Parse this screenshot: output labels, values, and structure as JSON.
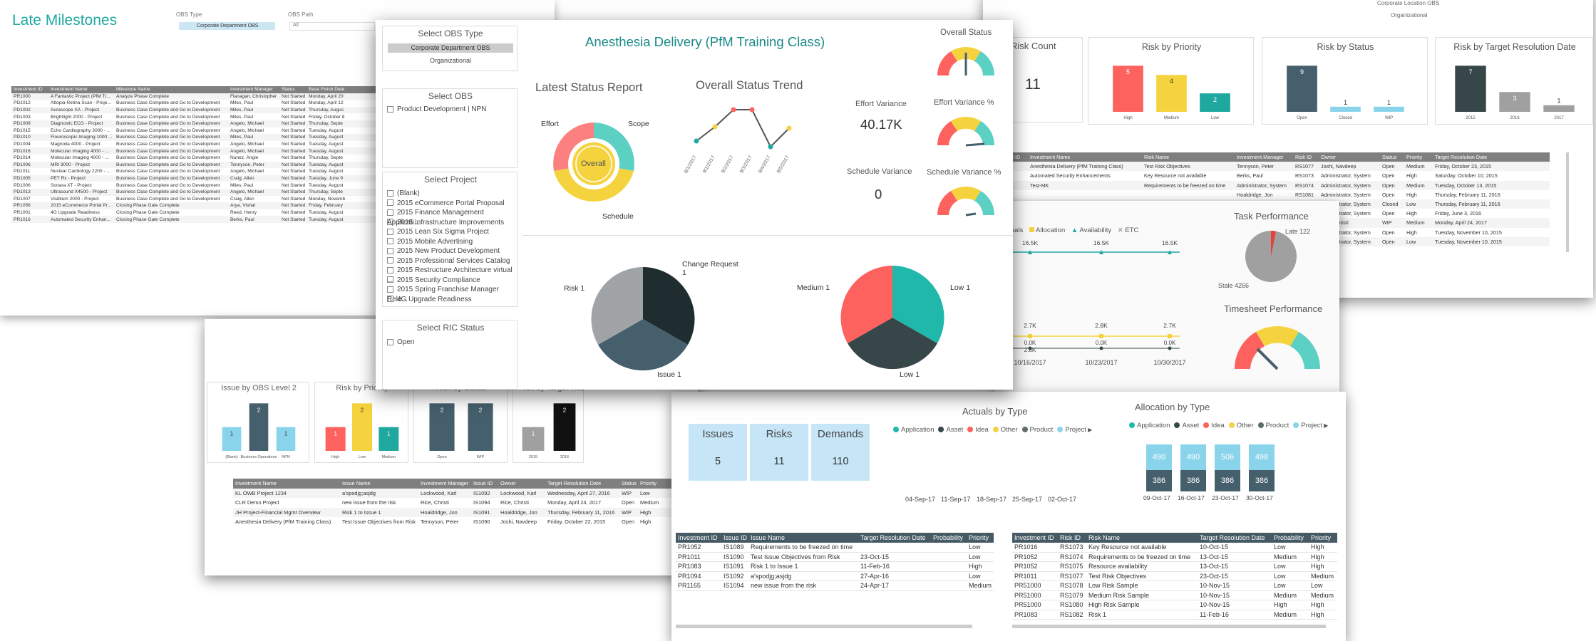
{
  "milestones": {
    "title": "Late Milestones",
    "obs_type_label": "OBS Type",
    "obs_type_value": "Corporate Department OBS",
    "obs_path_label": "OBS Path",
    "obs_path_value": "All",
    "inv_mgr_label": "Investment Manager",
    "headers": [
      "Investment ID",
      "Investment Name",
      "Milestone Name",
      "Investment Manager",
      "Status",
      "Base Finish Date"
    ],
    "rows": [
      [
        "PR1000",
        "A Fantastic Project (PfM Tr...",
        "Analyze Phase Complete",
        "Flanagan, Christopher",
        "Not Started",
        "Monday, April 20"
      ],
      [
        "PD1012",
        "Attopia Retina Scan - Proje...",
        "Business Case Complete and Go to Development",
        "Miles, Paul",
        "Not Started",
        "Monday, April 12"
      ],
      [
        "PD1002",
        "Aurascope XA - Project",
        "Business Case Complete and Go to Development",
        "Miles, Paul",
        "Not Started",
        "Thursday, Augus"
      ],
      [
        "PD1003",
        "Brightlight 2000 - Project",
        "Business Case Complete and Go to Development",
        "Miles, Paul",
        "Not Started",
        "Friday, October 8"
      ],
      [
        "PD1009",
        "Diagnostic ECG - Project",
        "Business Case Complete and Go to Development",
        "Angelo, Michael",
        "Not Started",
        "Thursday, Septe"
      ],
      [
        "PD1015",
        "Echo Cardiography 3000 - ...",
        "Business Case Complete and Go to Development",
        "Angelo, Michael",
        "Not Started",
        "Tuesday, August"
      ],
      [
        "PD1010",
        "Flouroscopic Imaging 1000 ...",
        "Business Case Complete and Go to Development",
        "Miles, Paul",
        "Not Started",
        "Tuesday, August"
      ],
      [
        "PD1004",
        "Magnolia 4000 - Project",
        "Business Case Complete and Go to Development",
        "Angelo, Michael",
        "Not Started",
        "Tuesday, August"
      ],
      [
        "PD1016",
        "Molecular Imaging 4000 - ...",
        "Business Case Complete and Go to Development",
        "Angelo, Michael",
        "Not Started",
        "Tuesday, August"
      ],
      [
        "PD1014",
        "Molecular Imaging 4000 - ...",
        "Business Case Complete and Go to Development",
        "Nunez, Angie",
        "Not Started",
        "Thursday, Septe"
      ],
      [
        "PD1006",
        "MRI 3000 - Project",
        "Business Case Complete and Go to Development",
        "Tennyson, Peter",
        "Not Started",
        "Tuesday, August"
      ],
      [
        "PD1011",
        "Nuclear Cardiology 2200 - ...",
        "Business Case Complete and Go to Development",
        "Angelo, Michael",
        "Not Started",
        "Tuesday, August"
      ],
      [
        "PD1005",
        "PET Rx - Project",
        "Business Case Complete and Go to Development",
        "Craig, Allen",
        "Not Started",
        "Tuesday, June 9"
      ],
      [
        "PD1006",
        "Sonara XT - Project",
        "Business Case Complete and Go to Development",
        "Miles, Paul",
        "Not Started",
        "Tuesday, August"
      ],
      [
        "PD1013",
        "Ultrasound X4500 - Project",
        "Business Case Complete and Go to Development",
        "Angelo, Michael",
        "Not Started",
        "Thursday, Septe"
      ],
      [
        "PD1007",
        "Visiblum 2000 - Project",
        "Business Case Complete and Go to Development",
        "Craig, Allen",
        "Not Started",
        "Monday, Novemb"
      ],
      [
        "PR1056",
        "2015 eCommerce Portal Pr...",
        "Closing Phase Gate Complete",
        "Arya, Vishal",
        "Not Started",
        "Friday, February"
      ],
      [
        "PR1001",
        "4G Upgrade Readiness",
        "Closing Phase Gate Complete",
        "Reed, Henry",
        "Not Started",
        "Tuesday, August"
      ],
      [
        "PR1016",
        "Automated Security Enhan...",
        "Closing Phase Gate Complete",
        "Berks, Paul",
        "Not Started",
        "Tuesday, August"
      ]
    ]
  },
  "risk_top": {
    "loc_obs": "Corporate Location OBS",
    "loc_val": "Organizational",
    "count_title": "Risk Count",
    "count_value": "11",
    "priority": {
      "title": "Risk by Priority",
      "cats": [
        "High",
        "Medium",
        "Low"
      ],
      "values": [
        5,
        4,
        2
      ]
    },
    "status": {
      "title": "Risk by Status",
      "cats": [
        "Open",
        "Closed",
        "WIP"
      ],
      "values": [
        9,
        1,
        1
      ]
    },
    "target": {
      "title": "Risk by Target Resolution Date",
      "cats": [
        "2015",
        "2016",
        "2017"
      ],
      "values": [
        7,
        3,
        1
      ]
    },
    "headers": [
      "Investment ID",
      "Investment Name",
      "Risk Name",
      "Investment Manager",
      "Risk ID",
      "Owner",
      "Status",
      "Priority",
      "Target Resolution Date"
    ],
    "rows": [
      [
        "PR1011",
        "Anesthesia Delivery (PfM Training Class)",
        "Test Risk Objectives",
        "Tennyson, Peter",
        "RS1077",
        "Joshi, Navdeep",
        "Open",
        "Medium",
        "Friday, October 23, 2015"
      ],
      [
        "PR1016",
        "Automated Security Enhancements",
        "Key Resource not available",
        "Berks, Paul",
        "RS1073",
        "Administrator, System",
        "Open",
        "High",
        "Saturday, October 10, 2015"
      ],
      [
        "PR1052",
        "Test-MK",
        "Requirements to be freezed on time",
        "Administrator, System",
        "RS1074",
        "Administrator, System",
        "Open",
        "Medium",
        "Tuesday, October 13, 2015"
      ],
      [
        "",
        "",
        "",
        "Hoaldridge, Jon",
        "RS1081",
        "Administrator, System",
        "Open",
        "High",
        "Thursday, February 11, 2016"
      ],
      [
        "",
        "",
        "",
        "Hoaldridge, Jon",
        "RS1082",
        "Administrator, System",
        "Closed",
        "Low",
        "Thursday, February 11, 2016"
      ],
      [
        "",
        "",
        "",
        "Calderon, Mindy",
        "RS1080",
        "Administrator, System",
        "Open",
        "High",
        "Friday, June 3, 2016"
      ],
      [
        "",
        "",
        "",
        "Rice, Christi",
        "RS1084",
        "Rice, Christi",
        "WIP",
        "Medium",
        "Monday, April 24, 2017"
      ],
      [
        "",
        "",
        "",
        "Administrator, System",
        "RS1079",
        "Administrator, System",
        "Open",
        "High",
        "Tuesday, November 10, 2015"
      ],
      [
        "",
        "",
        "",
        "Administrator, System",
        "RS1078",
        "Administrator, System",
        "Open",
        "Low",
        "Tuesday, November 10, 2015"
      ]
    ]
  },
  "issues_panel": {
    "obs": {
      "title": "Issue by OBS Level 2",
      "cats": [
        "(Blank)",
        "Business Operations",
        "NPN"
      ],
      "values": [
        1,
        2,
        1
      ]
    },
    "priority": {
      "title": "Risk by Priority",
      "cats": [
        "High",
        "Low",
        "Medium"
      ],
      "values": [
        1,
        2,
        1
      ]
    },
    "status": {
      "title": "Risk by Status",
      "cats": [
        "Open",
        "WIP"
      ],
      "values": [
        2,
        2
      ]
    },
    "target": {
      "title": "Risk by Target Res",
      "cats": [
        "2015",
        "2016"
      ],
      "values": [
        1,
        2
      ]
    },
    "headers": [
      "Investment Name",
      "Issue Name",
      "Investment Manager",
      "Issue ID",
      "Owner",
      "Target Resolution Date",
      "Status",
      "Priority"
    ],
    "rows": [
      [
        "KL OWB Project 1234",
        "a'spodjg;asjdg",
        "Lockwood, Karl",
        "IS1092",
        "Lockwood, Karl",
        "Wednesday, April 27, 2016",
        "WIP",
        "Low"
      ],
      [
        "CLR Demo Project",
        "new issue from the risk",
        "Rice, Christi",
        "IS1094",
        "Rice, Christi",
        "Monday, April 24, 2017",
        "Open",
        "Medium"
      ],
      [
        "JH Project-Financial Mgmt Overview",
        "Risk 1 to Issue 1",
        "Hoaldridge, Jon",
        "IS1091",
        "Hoaldridge, Jon",
        "Thursday, February 11, 2016",
        "WIP",
        "High"
      ],
      [
        "Anesthesia Delivery (PfM Training Class)",
        "Test Issue Objectives from Risk",
        "Tennyson, Peter",
        "IS1090",
        "Joshi, Navdeep",
        "Friday, October 22, 2015",
        "Open",
        "High"
      ]
    ]
  },
  "right_mid": {
    "legend": [
      "Actuals",
      "Allocation",
      "Availability",
      "ETC"
    ],
    "top_vals": [
      "16.5K",
      "16.5K",
      "16.5K"
    ],
    "low_vals": [
      "2.7K",
      "2.8K",
      "2.7K"
    ],
    "low_sub": [
      "0.0K",
      "0.0K",
      "0.0K"
    ],
    "low_sub2": [
      "2.8K",
      "",
      ""
    ],
    "dates": [
      "10/16/2017",
      "10/23/2017",
      "10/30/2017"
    ],
    "task_title": "Task Performance",
    "late": "Late 122",
    "stale": "Stale 4266",
    "timesheet_title": "Timesheet Performance"
  },
  "demand": {
    "tiles": [
      {
        "label": "Issues",
        "value": "5"
      },
      {
        "label": "Risks",
        "value": "11"
      },
      {
        "label": "Demands",
        "value": "110"
      }
    ],
    "actuals_title": "Actuals by Type",
    "types": [
      "Application",
      "Asset",
      "Idea",
      "Other",
      "Product",
      "Project"
    ],
    "actuals_dates": [
      "04-Sep-17",
      "11-Sep-17",
      "18-Sep-17",
      "25-Sep-17",
      "02-Oct-17"
    ],
    "alloc_title": "Allocation by Type",
    "alloc_top": [
      "490",
      "490",
      "506",
      "498"
    ],
    "alloc_bot": [
      "386",
      "386",
      "386",
      "386"
    ],
    "alloc_dates": [
      "09-Oct-17",
      "16-Oct-17",
      "23-Oct-17",
      "30-Oct-17"
    ],
    "issues_headers": [
      "Investment ID",
      "Issue ID",
      "Issue Name",
      "Target Resolution Date",
      "Probability",
      "Priority"
    ],
    "issues_rows": [
      [
        "PR1052",
        "IS1089",
        "Requirements to be freezed on time",
        "",
        "",
        "Low"
      ],
      [
        "PR1011",
        "IS1090",
        "Test Issue Objectives from Risk",
        "23-Oct-15",
        "",
        "Low"
      ],
      [
        "PR1083",
        "IS1091",
        "Risk 1 to Issue 1",
        "11-Feb-16",
        "",
        "High"
      ],
      [
        "PR1094",
        "IS1092",
        "a'spodjg;asjdg",
        "27-Apr-16",
        "",
        "Low"
      ],
      [
        "PR1165",
        "IS1094",
        "new issue from the risk",
        "24-Apr-17",
        "",
        "Medium"
      ]
    ],
    "risks_headers": [
      "Investment ID",
      "Risk ID",
      "Risk Name",
      "Target Resolution Date",
      "Probability",
      "Priority"
    ],
    "risks_rows": [
      [
        "PR1016",
        "RS1073",
        "Key Resource not available",
        "10-Oct-15",
        "Low",
        "High"
      ],
      [
        "PR1052",
        "RS1074",
        "Requirements to be freezed on time",
        "13-Oct-15",
        "Medium",
        "High"
      ],
      [
        "PR1052",
        "RS1075",
        "Resource availability",
        "13-Oct-15",
        "Low",
        "High"
      ],
      [
        "PR1011",
        "RS1077",
        "Test Risk Objectives",
        "23-Oct-15",
        "Low",
        "Medium"
      ],
      [
        "PR51000",
        "RS1078",
        "Low Risk Sample",
        "10-Nov-15",
        "Low",
        "Low"
      ],
      [
        "PR51000",
        "RS1079",
        "Medium Risk Sample",
        "10-Nov-15",
        "Medium",
        "Medium"
      ],
      [
        "PR51000",
        "RS1080",
        "High Risk Sample",
        "10-Nov-15",
        "High",
        "High"
      ],
      [
        "PR1083",
        "RS1082",
        "Risk 1",
        "11-Feb-16",
        "Medium",
        "High"
      ]
    ]
  },
  "front": {
    "obs_type_title": "Select OBS Type",
    "obs_type_opts": [
      "Corporate Department OBS",
      "Organizational"
    ],
    "obs_title": "Select OBS",
    "obs_opts": [
      "Product Development | NPN"
    ],
    "project_title": "Select Project",
    "projects": [
      "(Blank)",
      "2015 eCommerce Portal Proposal",
      "2015 Finance Management Applicati...",
      "2015 Infrastructure Improvements",
      "2015 Lean Six Sigma Project",
      "2015 Mobile Advertising",
      "2015 New Product Development",
      "2015 Professional Services Catalog",
      "2015 Restructure Architecture virtual ...",
      "2015 Security Compliance",
      "2015 Spring Franchise Manager Rele...",
      "4G Upgrade Readiness"
    ],
    "ric_title": "Select RIC Status",
    "ric_opts": [
      "Open"
    ],
    "title": "Anesthesia Delivery (PfM Training Class)",
    "overall_status": "Overall Status",
    "latest_title": "Latest Status Report",
    "effort": "Effort",
    "scope": "Scope",
    "schedule": "Schedule",
    "overall": "Overall",
    "trend_title": "Overall Status Trend",
    "trend_dates": [
      "8/1/2017",
      "9/1/2017",
      "9/2/2017",
      "9/3/2017",
      "9/4/2017",
      "9/5/2017"
    ],
    "effort_var_title": "Effort Variance",
    "effort_var": "40.17K",
    "effort_pct_title": "Effort Variance %",
    "sched_var_title": "Schedule Variance",
    "sched_var": "0",
    "sched_pct_title": "Schedule Variance %",
    "pie1": {
      "labels": [
        "Change Request",
        "Issue",
        "Risk"
      ],
      "values": [
        "1",
        "1",
        "1"
      ]
    },
    "pie2": {
      "labels": [
        "Low",
        "Low",
        "Medium"
      ],
      "values": [
        "1",
        "1",
        "1"
      ]
    }
  },
  "colors": {
    "teal": "#1fa8a0",
    "red": "#fd625e",
    "yellow": "#f5d33f",
    "dark": "#374649",
    "slate": "#455f6c",
    "grey": "#a0a0a0",
    "lightblue": "#8ad4eb"
  }
}
